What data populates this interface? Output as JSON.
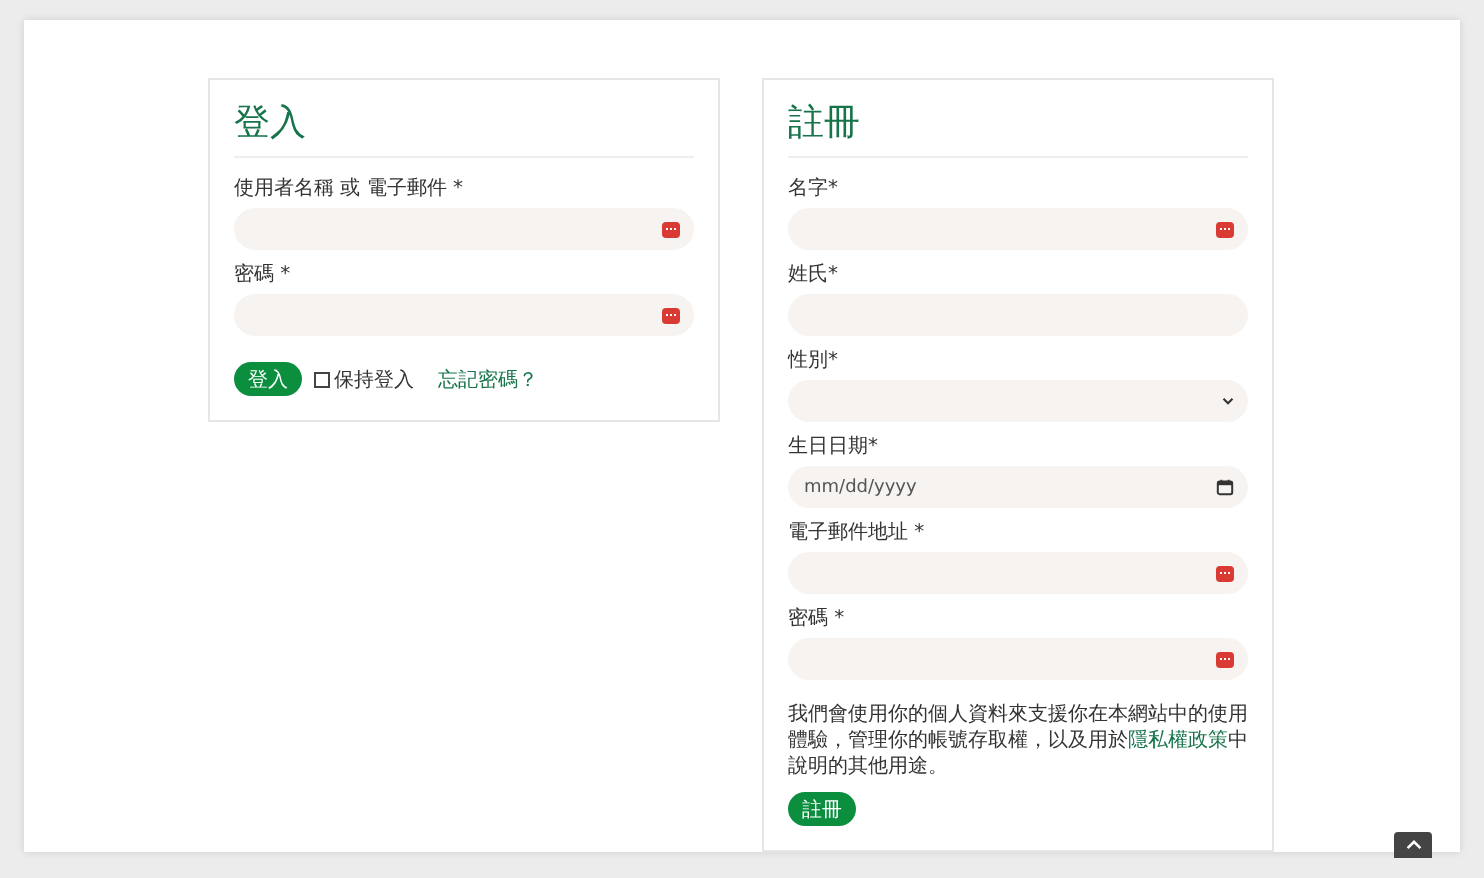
{
  "login": {
    "title": "登入",
    "fields": [
      {
        "label": "使用者名稱 或 電子郵件 *",
        "autofill_icon": true
      },
      {
        "label": "密碼 *",
        "autofill_icon": true
      }
    ],
    "submit": "登入",
    "remember": {
      "label": "保持登入",
      "checked": false
    },
    "forgot_link": "忘記密碼？"
  },
  "register": {
    "title": "註冊",
    "fields": [
      {
        "label": "名字*",
        "kind": "text",
        "autofill_icon": true
      },
      {
        "label": "姓氏*",
        "kind": "text",
        "autofill_icon": false
      },
      {
        "label": "性別*",
        "kind": "select",
        "autofill_icon": false
      },
      {
        "label": "生日日期*",
        "kind": "date",
        "placeholder": "mm/dd/yyyy",
        "autofill_icon": false
      },
      {
        "label": "電子郵件地址 *",
        "kind": "text",
        "autofill_icon": true
      },
      {
        "label": "密碼 *",
        "kind": "text",
        "autofill_icon": true
      }
    ],
    "notice": {
      "before": "我們會使用你的個人資料來支援你在本網站中的使用體驗，管理你的帳號存取權，以及用於",
      "link": "隱私權政策",
      "after": "中說明的其他用途。"
    },
    "submit": "註冊"
  }
}
